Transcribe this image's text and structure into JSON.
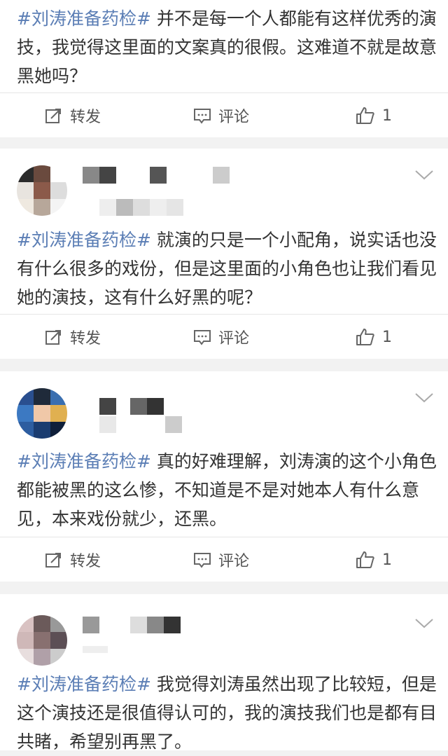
{
  "posts": [
    {
      "hashtag": "#刘涛准备药检#",
      "text": "并不是每一个人都能有这样优秀的演技，我觉得这里面的文案真的很假。这难道不就是故意黑她吗？",
      "repost_label": "转发",
      "comment_label": "评论",
      "like_count": "1"
    },
    {
      "hashtag": "#刘涛准备药检#",
      "text": "就演的只是一个小配角，说实话也没有什么很多的戏份，但是这里面的小角色也让我们看见她的演技，这有什么好黑的呢？",
      "repost_label": "转发",
      "comment_label": "评论",
      "like_count": "1"
    },
    {
      "hashtag": "#刘涛准备药检#",
      "text": "真的好难理解，刘涛演的这个小角色都能被黑的这么惨，不知道是不是对她本人有什么意见，本来戏份就少，还黑。",
      "repost_label": "转发",
      "comment_label": "评论",
      "like_count": "1"
    },
    {
      "hashtag": "#刘涛准备药检#",
      "text": "我觉得刘涛虽然出现了比较短，但是这个演技还是很值得认可的，我的演技我们也是都有目共睹，希望别再黑了。"
    }
  ],
  "icons": {
    "repost": "repost-icon",
    "comment": "comment-icon",
    "like": "thumbs-up-icon",
    "more": "chevron-down-icon"
  },
  "colors": {
    "hashtag": "#5b7eb5",
    "text": "#333333",
    "background": "#f2f2f2"
  }
}
